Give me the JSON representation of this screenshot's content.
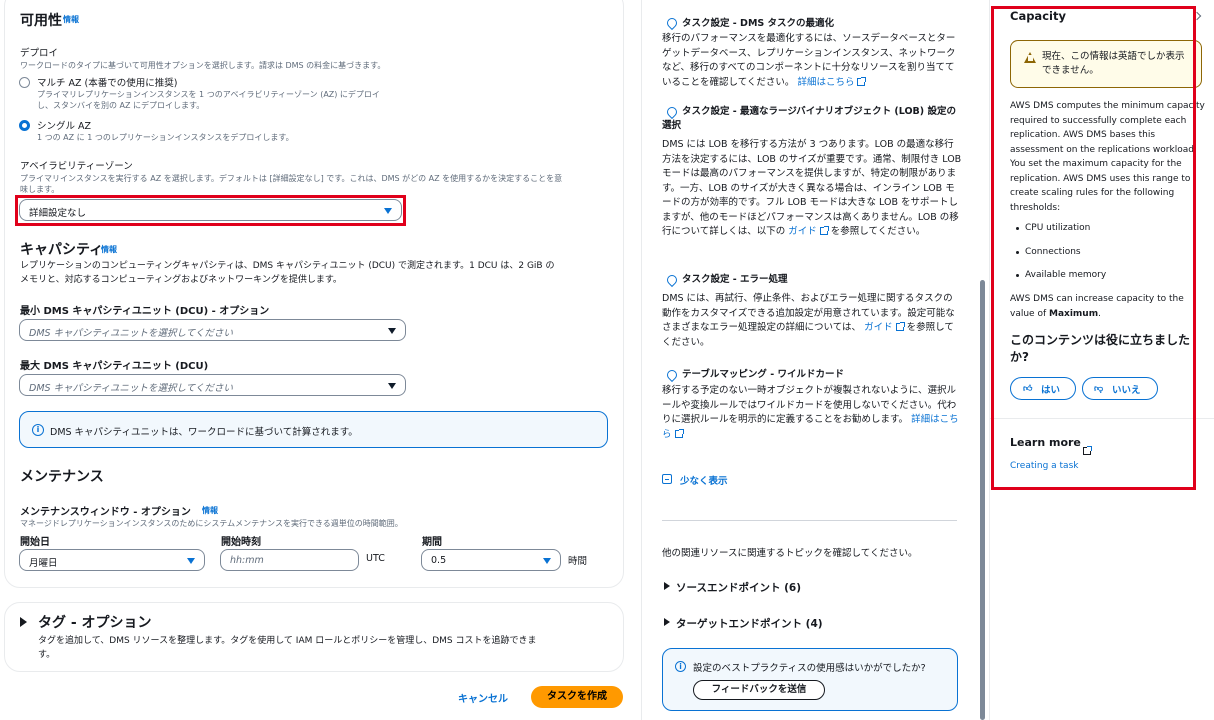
{
  "form": {
    "availability": {
      "title": "可用性",
      "info": "情報"
    },
    "deploy": {
      "label": "デプロイ",
      "desc": "ワークロードのタイプに基づいて可用性オプションを選択します。請求は DMS の料金に基づきます。",
      "multi_az_label": "マルチ AZ (本番での使用に推奨)",
      "multi_az_desc_1": "プライマリレプリケーションインスタンスを 1 つのアベイラビリティーゾーン (AZ) にデプロイ",
      "multi_az_desc_2": "し、スタンバイを別の AZ にデプロイします。",
      "single_az_label": "シングル AZ",
      "single_az_desc": "1 つの AZ に 1 つのレプリケーションインスタンスをデプロイします。",
      "selected": "シングル AZ"
    },
    "az": {
      "label": "アベイラビリティーゾーン",
      "desc_1": "プライマリインスタンスを実行する AZ を選択します。デフォルトは [詳細設定なし] です。これは、DMS がどの AZ を使用するかを決定することを意",
      "desc_2": "味します。",
      "value": "詳細設定なし"
    },
    "capacity": {
      "title": "キャパシティ",
      "info": "情報",
      "desc_1": "レプリケーションのコンピューティングキャパシティは、DMS キャパシティユニット (DCU) で測定されます。1 DCU は、2 GiB の",
      "desc_2": "メモリと、対応するコンピューティングおよびネットワーキングを提供します。",
      "min_label": "最小 DMS キャパシティユニット (DCU) - オプション",
      "min_placeholder": "DMS キャパシティユニットを選択してください",
      "max_label": "最大 DMS キャパシティユニット (DCU)",
      "max_placeholder": "DMS キャパシティユニットを選択してください",
      "alert": "DMS キャパシティユニットは、ワークロードに基づいて計算されます。"
    },
    "maintenance": {
      "title": "メンテナンス",
      "window_label": "メンテナンスウィンドウ - オプション",
      "info": "情報",
      "window_desc": "マネージドレプリケーションインスタンスのためにシステムメンテナンスを実行できる週単位の時間範囲。",
      "start_day_label": "開始日",
      "start_day_value": "月曜日",
      "start_time_label": "開始時刻",
      "start_time_placeholder": "hh:mm",
      "utc": "UTC",
      "duration_label": "期間",
      "duration_value": "0.5",
      "hours": "時間"
    },
    "tags": {
      "title": "タグ - オプション",
      "desc_1": "タグを追加して、DMS リソースを整理します。タグを使用して IAM ロールとポリシーを管理し、DMS コストを追跡できま",
      "desc_2": "す。"
    },
    "cancel": "キャンセル",
    "create": "タスクを作成"
  },
  "help": {
    "s1": {
      "title": "タスク設定 - DMS タスクの最適化",
      "body": "移行のパフォーマンスを最適化するには、ソースデータベースとターゲットデータベース、レプリケーションインスタンス、ネットワークなど、移行のすべてのコンポーネントに十分なリソースを割り当てていることを確認してください。",
      "link": "詳細はこちら"
    },
    "s2": {
      "title": "タスク設定 - 最適なラージバイナリオブジェクト (LOB) 設定の選択",
      "body": "DMS には LOB を移行する方法が 3 つあります。LOB の最適な移行方法を決定するには、LOB のサイズが重要です。通常、制限付き LOB モードは最高のパフォーマンスを提供しますが、特定の制限があります。一方、LOB のサイズが大きく異なる場合は、インライン LOB モードの方が効率的です。フル LOB モードは大きな LOB をサポートしますが、他のモードほどパフォーマンスは高くありません。LOB の移行について詳しくは、以下の",
      "link": "ガイド",
      "tail": "を参照してください。"
    },
    "s3": {
      "title": "タスク設定 - エラー処理",
      "body": "DMS には、再試行、停止条件、およびエラー処理に関するタスクの動作をカスタマイズできる追加設定が用意されています。設定可能なさまざまなエラー処理設定の詳細については、",
      "link": "ガイド",
      "tail": "を参照してください。"
    },
    "s4": {
      "title": "テーブルマッピング - ワイルドカード",
      "body": "移行する予定のない一時オブジェクトが複製されないように、選択ルールや変換ルールではワイルドカードを使用しないでください。代わりに選択ルールを明示的に定義することをお勧めします。",
      "link": "詳細はこちら"
    },
    "show_less": "少なく表示",
    "related": "他の関連リソースに関連するトピックを確認してください。",
    "source_endpoints": "ソースエンドポイント (6)",
    "target_endpoints": "ターゲットエンドポイント (4)",
    "feedback_question": "設定のベストプラクティスの使用感はいかがでしたか?",
    "feedback_button": "フィードバックを送信"
  },
  "panel": {
    "title": "Capacity",
    "warning": "現在、この情報は英語でしか表示できません。",
    "body": "AWS DMS computes the minimum capacity required to successfully complete each replication. AWS DMS bases this assessment on the replications workload. You set the maximum capacity for the replication. AWS DMS uses this range to create scaling rules for the following thresholds:",
    "bullets": [
      "CPU utilization",
      "Connections",
      "Available memory"
    ],
    "max_text_pre": "AWS DMS can increase capacity to the value of ",
    "max_text_bold": "Maximum",
    "max_text_post": ".",
    "helpful_q": "このコンテンツは役に立ちましたか?",
    "yes": "はい",
    "no": "いいえ",
    "learn_more": "Learn more",
    "learn_link": "Creating a task"
  },
  "colors": {
    "accent": "#0972d3",
    "primary_button": "#ff9900",
    "highlight": "#e0001b",
    "warning_bg": "#fffce9"
  }
}
